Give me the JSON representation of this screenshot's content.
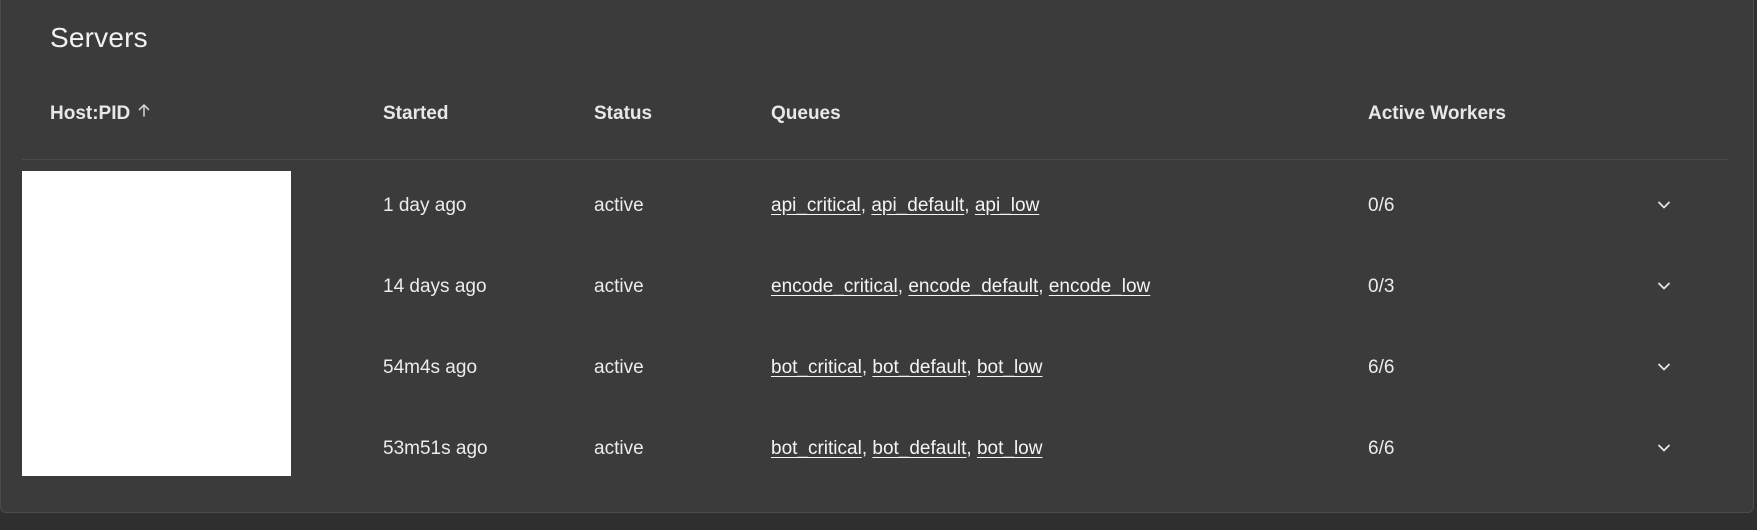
{
  "panel": {
    "title": "Servers"
  },
  "columns": {
    "host_pid": "Host:PID",
    "started": "Started",
    "status": "Status",
    "queues": "Queues",
    "active_workers": "Active Workers"
  },
  "sort": {
    "column": "host_pid",
    "direction": "ascending",
    "icon": "arrow-up-icon"
  },
  "rows": [
    {
      "started": "1 day ago",
      "status": "active",
      "queues": [
        "api_critical",
        "api_default",
        "api_low"
      ],
      "workers": "0/6"
    },
    {
      "started": "14 days ago",
      "status": "active",
      "queues": [
        "encode_critical",
        "encode_default",
        "encode_low"
      ],
      "workers": "0/3"
    },
    {
      "started": "54m4s ago",
      "status": "active",
      "queues": [
        "bot_critical",
        "bot_default",
        "bot_low"
      ],
      "workers": "6/6"
    },
    {
      "started": "53m51s ago",
      "status": "active",
      "queues": [
        "bot_critical",
        "bot_default",
        "bot_low"
      ],
      "workers": "6/6"
    }
  ],
  "colors": {
    "page_bg": "#2f2f2f",
    "panel_bg": "#3b3b3b",
    "text": "#ececec",
    "redaction": "#ffffff"
  }
}
